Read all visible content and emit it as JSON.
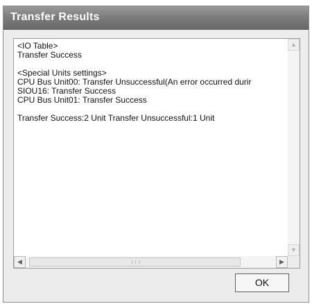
{
  "window": {
    "title": "Transfer Results"
  },
  "results": {
    "lines": [
      "<IO Table>",
      "Transfer Success",
      "",
      "<Special Units settings>",
      "CPU Bus Unit00: Transfer Unsuccessful(An error occurred durir",
      "SIOU16: Transfer Success",
      "CPU Bus Unit01: Transfer Success",
      "",
      "Transfer Success:2 Unit   Transfer Unsuccessful:1 Unit"
    ]
  },
  "buttons": {
    "ok_label": "OK"
  },
  "icons": {
    "scroll_up": "chevron-up-icon",
    "scroll_down": "chevron-down-icon",
    "scroll_left": "chevron-left-icon",
    "scroll_right": "chevron-right-icon"
  }
}
